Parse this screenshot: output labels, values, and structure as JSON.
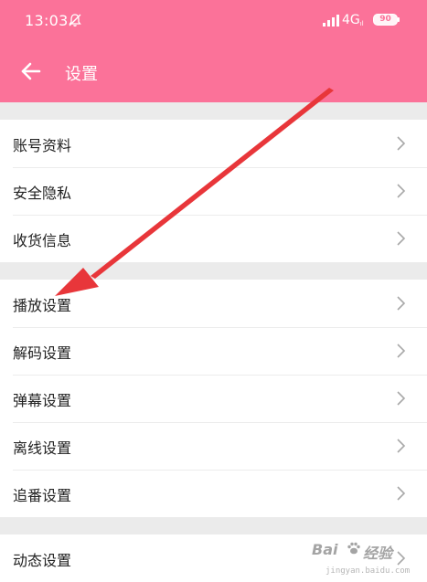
{
  "status_bar": {
    "time": "13:03",
    "network": "4G",
    "network_sub": "ıl",
    "battery": "90"
  },
  "header": {
    "title": "设置"
  },
  "groups": [
    {
      "items": [
        {
          "label": "账号资料"
        },
        {
          "label": "安全隐私"
        },
        {
          "label": "收货信息"
        }
      ]
    },
    {
      "items": [
        {
          "label": "播放设置"
        },
        {
          "label": "解码设置"
        },
        {
          "label": "弹幕设置"
        },
        {
          "label": "离线设置"
        },
        {
          "label": "追番设置"
        }
      ]
    },
    {
      "items": [
        {
          "label": "动态设置"
        }
      ]
    }
  ],
  "watermark": {
    "brand_a": "Bai",
    "brand_b": "经验",
    "sub": "jingyan.baidu.com"
  },
  "icons": {
    "back": "arrow-left-icon",
    "chevron": "chevron-right-icon",
    "mute": "bell-off-icon",
    "signal": "signal-icon",
    "annotation": "red-arrow"
  },
  "colors": {
    "header": "#fb7299",
    "background": "#ebebeb",
    "row": "#ffffff",
    "annotation": "#e8363a"
  }
}
